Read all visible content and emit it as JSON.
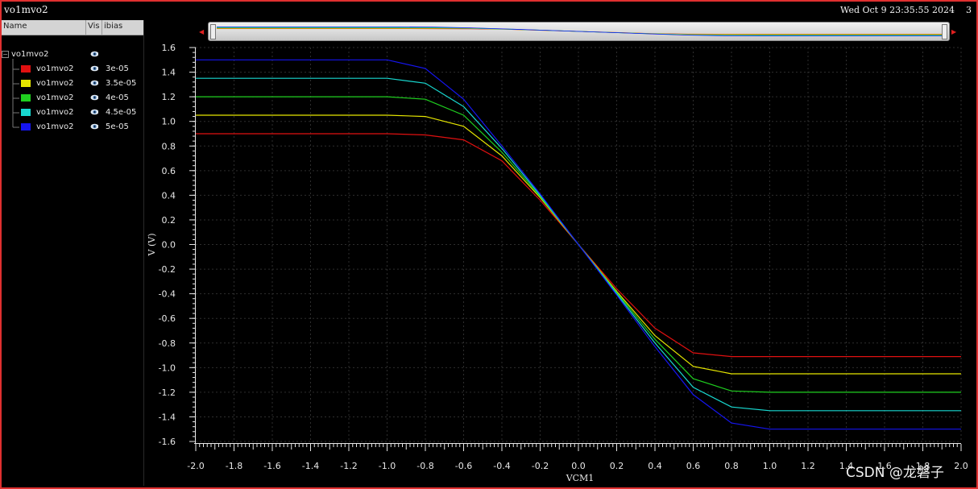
{
  "window": {
    "title": "vo1mvo2",
    "datetime": "Wed Oct 9 23:35:55 2024",
    "page_number": "3"
  },
  "browser": {
    "columns": [
      "Name",
      "Vis",
      "ibias"
    ],
    "root": "vo1mvo2",
    "items": [
      {
        "name": "vo1mvo2",
        "ibias": "3e-05",
        "color": "#e01010"
      },
      {
        "name": "vo1mvo2",
        "ibias": "3.5e-05",
        "color": "#e6e600"
      },
      {
        "name": "vo1mvo2",
        "ibias": "4e-05",
        "color": "#1fcf1f"
      },
      {
        "name": "vo1mvo2",
        "ibias": "4.5e-05",
        "color": "#18d8d0"
      },
      {
        "name": "vo1mvo2",
        "ibias": "5e-05",
        "color": "#1515f0"
      }
    ]
  },
  "watermark": "CSDN @龙磐子",
  "chart_data": {
    "type": "line",
    "xlabel": "VCM1",
    "ylabel": "V (V)",
    "xlim": [
      -2.0,
      2.0
    ],
    "ylim": [
      -1.6,
      1.6
    ],
    "xticks": [
      "-2.0",
      "-1.8",
      "-1.6",
      "-1.4",
      "-1.2",
      "-1.0",
      "-0.8",
      "-0.6",
      "-0.4",
      "-0.2",
      "0.0",
      "0.2",
      "0.4",
      "0.6",
      "0.8",
      "1.0",
      "1.2",
      "1.4",
      "1.6",
      "1.8",
      "2.0"
    ],
    "yticks": [
      "1.6",
      "1.4",
      "1.2",
      "1.0",
      "0.8",
      "0.6",
      "0.4",
      "0.2",
      "0.0",
      "-0.2",
      "-0.4",
      "-0.6",
      "-0.8",
      "-1.0",
      "-1.2",
      "-1.4",
      "-1.6"
    ],
    "grid": true,
    "x": [
      -2.0,
      -1.0,
      -0.8,
      -0.6,
      -0.4,
      -0.2,
      0.0,
      0.2,
      0.4,
      0.6,
      0.8,
      1.0,
      2.0
    ],
    "series": [
      {
        "name": "3e-05",
        "color": "#e01010",
        "values": [
          0.9,
          0.9,
          0.89,
          0.85,
          0.68,
          0.36,
          0.0,
          -0.36,
          -0.68,
          -0.88,
          -0.91,
          -0.91,
          -0.91
        ]
      },
      {
        "name": "3.5e-05",
        "color": "#e6e600",
        "values": [
          1.05,
          1.05,
          1.04,
          0.96,
          0.72,
          0.38,
          0.0,
          -0.38,
          -0.74,
          -0.99,
          -1.05,
          -1.05,
          -1.05
        ]
      },
      {
        "name": "4e-05",
        "color": "#1fcf1f",
        "values": [
          1.2,
          1.2,
          1.18,
          1.05,
          0.75,
          0.39,
          0.0,
          -0.39,
          -0.77,
          -1.09,
          -1.19,
          -1.2,
          -1.2
        ]
      },
      {
        "name": "4.5e-05",
        "color": "#18d8d0",
        "values": [
          1.35,
          1.35,
          1.31,
          1.12,
          0.78,
          0.4,
          0.0,
          -0.4,
          -0.8,
          -1.16,
          -1.32,
          -1.35,
          -1.35
        ]
      },
      {
        "name": "5e-05",
        "color": "#1515f0",
        "values": [
          1.5,
          1.5,
          1.43,
          1.18,
          0.8,
          0.41,
          0.0,
          -0.41,
          -0.83,
          -1.22,
          -1.45,
          -1.5,
          -1.5
        ]
      }
    ]
  }
}
